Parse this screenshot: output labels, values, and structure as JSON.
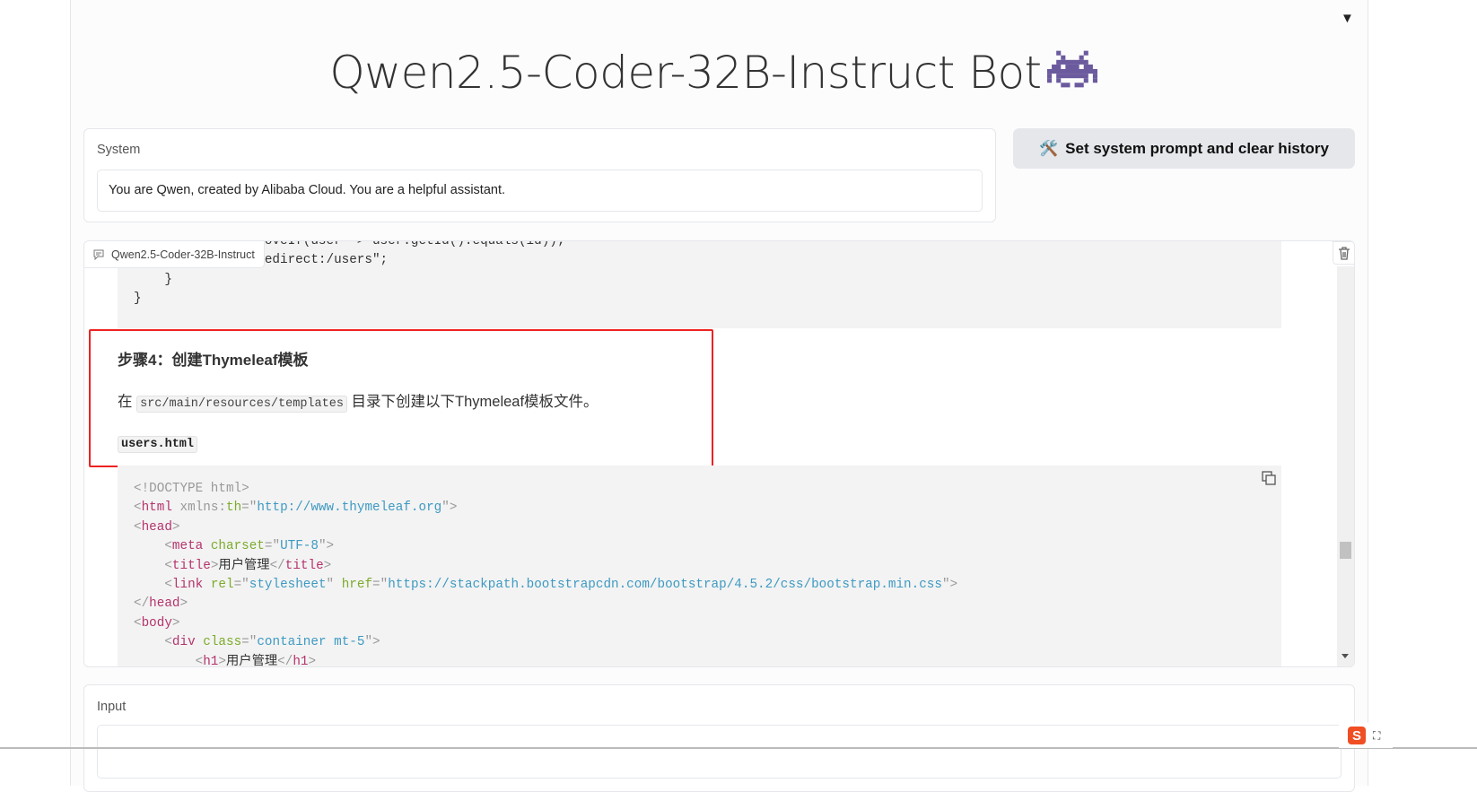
{
  "header": {
    "title": "Qwen2.5-Coder-32B-Instruct Bot",
    "collapse_icon": "triangle-down"
  },
  "system": {
    "label": "System",
    "value": "You are Qwen, created by Alibaba Cloud. You are a helpful assistant."
  },
  "set_button": {
    "label": "Set system prompt and clear history",
    "icon": "hammer-wrench"
  },
  "chatbot": {
    "label": "Qwen2.5-Coder-32B-Instruct",
    "code_top": [
      [
        [
          "        users.removeIf(user -> user.getId().equals(id));",
          "t-txt"
        ]
      ],
      [
        [
          "        return \"redirect:/users\";",
          "t-txt"
        ]
      ],
      [
        [
          "    }",
          "t-txt"
        ]
      ],
      [
        [
          "}",
          "t-txt"
        ]
      ]
    ],
    "step_heading": "步骤4：创建Thymeleaf模板",
    "step_text_before": "在",
    "step_code": "src/main/resources/templates",
    "step_text_after": "目录下创建以下Thymeleaf模板文件。",
    "file_name": "users.html",
    "code_bottom": [
      [
        [
          "<!DOCTYPE html>",
          "t-p"
        ]
      ],
      [
        [
          "<",
          "t-p"
        ],
        [
          "html",
          "t-tag"
        ],
        [
          " xmlns:",
          "t-p"
        ],
        [
          "th",
          "t-attr"
        ],
        [
          "=\"",
          "t-p"
        ],
        [
          "http://www.thymeleaf.org",
          "t-str"
        ],
        [
          "\">",
          "t-p"
        ]
      ],
      [
        [
          "<",
          "t-p"
        ],
        [
          "head",
          "t-tag"
        ],
        [
          ">",
          "t-p"
        ]
      ],
      [
        [
          "    <",
          "t-p"
        ],
        [
          "meta",
          "t-tag"
        ],
        [
          " ",
          "t-p"
        ],
        [
          "charset",
          "t-attr"
        ],
        [
          "=\"",
          "t-p"
        ],
        [
          "UTF-8",
          "t-str"
        ],
        [
          "\">",
          "t-p"
        ]
      ],
      [
        [
          "    <",
          "t-p"
        ],
        [
          "title",
          "t-tag"
        ],
        [
          ">",
          "t-p"
        ],
        [
          "用户管理",
          "t-txt"
        ],
        [
          "</",
          "t-p"
        ],
        [
          "title",
          "t-tag"
        ],
        [
          ">",
          "t-p"
        ]
      ],
      [
        [
          "    <",
          "t-p"
        ],
        [
          "link",
          "t-tag"
        ],
        [
          " ",
          "t-p"
        ],
        [
          "rel",
          "t-attr"
        ],
        [
          "=\"",
          "t-p"
        ],
        [
          "stylesheet",
          "t-str"
        ],
        [
          "\" ",
          "t-p"
        ],
        [
          "href",
          "t-attr"
        ],
        [
          "=\"",
          "t-p"
        ],
        [
          "https://stackpath.bootstrapcdn.com/bootstrap/4.5.2/css/bootstrap.min.css",
          "t-str"
        ],
        [
          "\">",
          "t-p"
        ]
      ],
      [
        [
          "</",
          "t-p"
        ],
        [
          "head",
          "t-tag"
        ],
        [
          ">",
          "t-p"
        ]
      ],
      [
        [
          "<",
          "t-p"
        ],
        [
          "body",
          "t-tag"
        ],
        [
          ">",
          "t-p"
        ]
      ],
      [
        [
          "    <",
          "t-p"
        ],
        [
          "div",
          "t-tag"
        ],
        [
          " ",
          "t-p"
        ],
        [
          "class",
          "t-attr"
        ],
        [
          "=\"",
          "t-p"
        ],
        [
          "container mt-5",
          "t-str"
        ],
        [
          "\">",
          "t-p"
        ]
      ],
      [
        [
          "        <",
          "t-p"
        ],
        [
          "h1",
          "t-tag"
        ],
        [
          ">",
          "t-p"
        ],
        [
          "用户管理",
          "t-txt"
        ],
        [
          "</",
          "t-p"
        ],
        [
          "h1",
          "t-tag"
        ],
        [
          ">",
          "t-p"
        ]
      ]
    ],
    "scroll_fraction": 0.72
  },
  "input": {
    "label": "Input",
    "value": ""
  },
  "colors": {
    "highlight": "#ee2222",
    "button_bg": "#e5e7eb",
    "tag": "#b5336c",
    "attr": "#7cab2c",
    "string": "#3e9ac2"
  }
}
